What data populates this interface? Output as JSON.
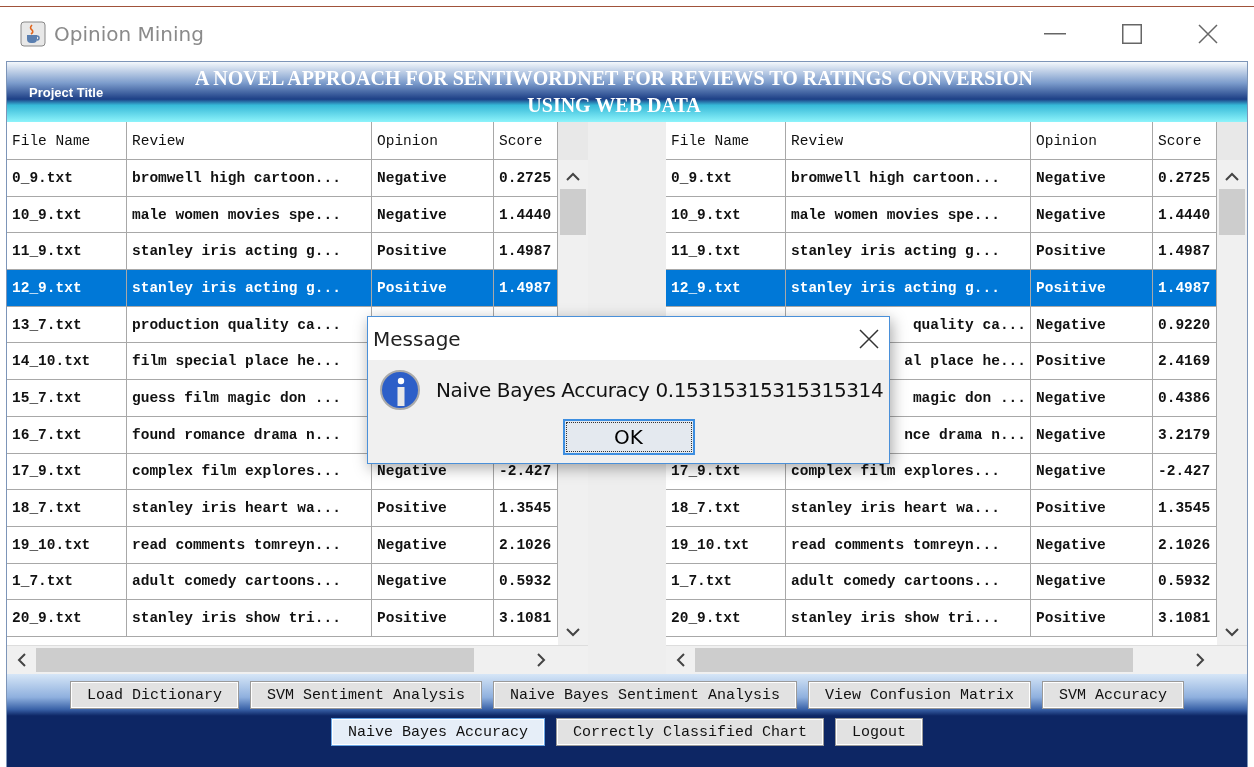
{
  "window": {
    "title": "Opinion Mining"
  },
  "header": {
    "label": "Project Title",
    "title": "A NOVEL APPROACH FOR SENTIWORDNET FOR REVIEWS TO RATINGS CONVERSION USING WEB DATA"
  },
  "tables": [
    {
      "columns": [
        "File Name",
        "Review",
        "Opinion",
        "Score"
      ],
      "rows": [
        {
          "file_name": "0_9.txt",
          "review": "bromwell high cartoon...",
          "opinion": "Negative",
          "score": "0.2725",
          "selected": false
        },
        {
          "file_name": "10_9.txt",
          "review": "male women movies spe...",
          "opinion": "Negative",
          "score": "1.4440",
          "selected": false
        },
        {
          "file_name": "11_9.txt",
          "review": "stanley iris acting g...",
          "opinion": "Positive",
          "score": "1.4987",
          "selected": false
        },
        {
          "file_name": "12_9.txt",
          "review": "stanley iris acting g...",
          "opinion": "Positive",
          "score": "1.4987",
          "selected": true
        },
        {
          "file_name": "13_7.txt",
          "review": "production quality ca...",
          "selected": false
        },
        {
          "file_name": "14_10.txt",
          "review": "film special place he...",
          "selected": false
        },
        {
          "file_name": "15_7.txt",
          "review": "guess film magic don ...",
          "selected": false
        },
        {
          "file_name": "16_7.txt",
          "review": "found romance drama n...",
          "selected": false
        },
        {
          "file_name": "17_9.txt",
          "review": "complex film explores...",
          "opinion": "Negative",
          "score": "-2.427",
          "selected": false
        },
        {
          "file_name": "18_7.txt",
          "review": "stanley iris heart wa...",
          "opinion": "Positive",
          "score": "1.3545",
          "selected": false
        },
        {
          "file_name": "19_10.txt",
          "review": "read comments tomreyn...",
          "opinion": "Negative",
          "score": "2.1026",
          "selected": false
        },
        {
          "file_name": "1_7.txt",
          "review": "adult comedy cartoons...",
          "opinion": "Negative",
          "score": "0.5932",
          "selected": false
        },
        {
          "file_name": "20_9.txt",
          "review": "stanley iris show tri...",
          "opinion": "Positive",
          "score": "3.1081",
          "selected": false
        }
      ]
    },
    {
      "columns": [
        "File Name",
        "Review",
        "Opinion",
        "Score"
      ],
      "rows": [
        {
          "file_name": "0_9.txt",
          "review": "bromwell high cartoon...",
          "opinion": "Negative",
          "score": "0.2725",
          "selected": false
        },
        {
          "file_name": "10_9.txt",
          "review": "male women movies spe...",
          "opinion": "Negative",
          "score": "1.4440",
          "selected": false
        },
        {
          "file_name": "11_9.txt",
          "review": "stanley iris acting g...",
          "opinion": "Positive",
          "score": "1.4987",
          "selected": false
        },
        {
          "file_name": "12_9.txt",
          "review": "stanley iris acting g...",
          "opinion": "Positive",
          "score": "1.4987",
          "selected": true
        },
        {
          "review_tail": "quality ca...",
          "opinion": "Negative",
          "score": "0.9220",
          "selected": false
        },
        {
          "review_tail": "al place he...",
          "opinion": "Positive",
          "score": "2.4169",
          "selected": false
        },
        {
          "review_tail": "magic don ...",
          "opinion": "Negative",
          "score": "0.4386",
          "selected": false
        },
        {
          "review_tail": "nce drama n...",
          "opinion": "Negative",
          "score": "3.2179",
          "selected": false
        },
        {
          "file_name": "17_9.txt",
          "review": "complex film explores...",
          "opinion": "Negative",
          "score": "-2.427",
          "selected": false
        },
        {
          "file_name": "18_7.txt",
          "review": "stanley iris heart wa...",
          "opinion": "Positive",
          "score": "1.3545",
          "selected": false
        },
        {
          "file_name": "19_10.txt",
          "review": "read comments tomreyn...",
          "opinion": "Negative",
          "score": "2.1026",
          "selected": false
        },
        {
          "file_name": "1_7.txt",
          "review": "adult comedy cartoons...",
          "opinion": "Negative",
          "score": "0.5932",
          "selected": false
        },
        {
          "file_name": "20_9.txt",
          "review": "stanley iris show tri...",
          "opinion": "Positive",
          "score": "3.1081",
          "selected": false
        }
      ]
    }
  ],
  "button_rows": [
    [
      {
        "label": "Load Dictionary",
        "selected": false
      },
      {
        "label": "SVM Sentiment Analysis",
        "selected": false
      },
      {
        "label": "Naive Bayes Sentiment Analysis",
        "selected": false
      },
      {
        "label": "View Confusion Matrix",
        "selected": false
      },
      {
        "label": "SVM Accuracy",
        "selected": false
      }
    ],
    [
      {
        "label": "Naive Bayes Accuracy",
        "selected": true
      },
      {
        "label": "Correctly Classified Chart",
        "selected": false
      },
      {
        "label": "Logout",
        "selected": false
      }
    ]
  ],
  "dialog": {
    "title": "Message",
    "message": "Naive Bayes Accuracy 0.15315315315315314",
    "button": "OK"
  }
}
